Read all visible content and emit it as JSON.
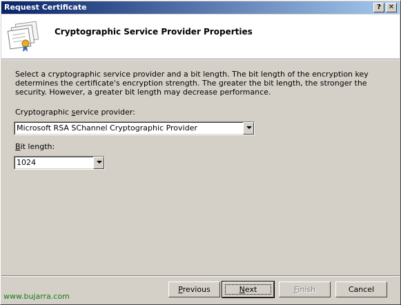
{
  "window": {
    "title": "Request Certificate",
    "help_glyph": "?",
    "close_glyph": "✕"
  },
  "header": {
    "title": "Cryptographic Service Provider Properties"
  },
  "description": "Select a cryptographic service provider and a bit length. The bit length of the encryption key determines the certificate's encryption strength. The greater the bit length, the stronger the security. However, a greater bit length may decrease performance.",
  "csp": {
    "label_pre": "Cryptographic ",
    "label_accel": "s",
    "label_post": "ervice provider:",
    "value": "Microsoft RSA SChannel Cryptographic Provider"
  },
  "bitlength": {
    "label_accel": "B",
    "label_post": "it length:",
    "value": "1024"
  },
  "buttons": {
    "previous_accel": "P",
    "previous_rest": "revious",
    "next_accel": "N",
    "next_rest": "ext",
    "finish_accel": "F",
    "finish_rest": "inish",
    "cancel": "Cancel"
  },
  "watermark": "www.bujarra.com"
}
